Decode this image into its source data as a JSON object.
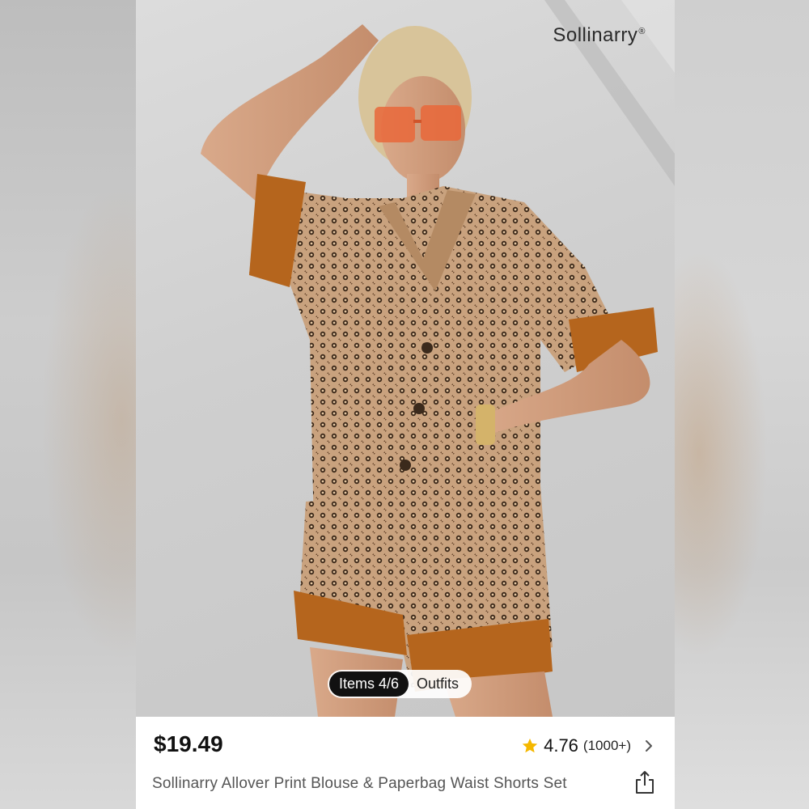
{
  "brand": {
    "name": "Sollinarry",
    "trademark": "®"
  },
  "gallery": {
    "items_label": "Items 4/6",
    "outfits_label": "Outfits"
  },
  "product": {
    "price": "$19.49",
    "rating": "4.76",
    "review_count": "(1000+)",
    "title": "Sollinarry Allover Print Blouse & Paperbag Waist Shorts Set"
  },
  "colors": {
    "accent_star": "#F5B800",
    "fabric": "#C9A27E",
    "trim": "#B5651D"
  },
  "icons": [
    "star-icon",
    "chevron-right-icon",
    "share-icon"
  ]
}
